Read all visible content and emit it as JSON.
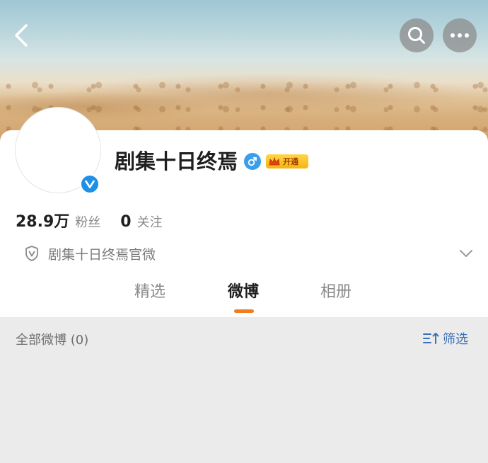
{
  "header": {
    "back_icon": "chevron-left-icon",
    "search_icon": "search-icon",
    "more_icon": "more-horizontal-icon"
  },
  "profile": {
    "name": "剧集十日终焉",
    "gender_icon": "male-icon",
    "vip_label": "开通",
    "verified_icon": "verified-v-icon",
    "followers_count": "28.9万",
    "followers_label": "粉丝",
    "following_count": "0",
    "following_label": "关注",
    "verification_text": "剧集十日终焉官微"
  },
  "tabs": [
    {
      "label": "精选",
      "active": false
    },
    {
      "label": "微博",
      "active": true
    },
    {
      "label": "相册",
      "active": false
    }
  ],
  "feed": {
    "count_label": "全部微博 (0)",
    "filter_label": "筛选"
  },
  "colors": {
    "accent": "#f07c22",
    "link_blue": "#3b6fb6",
    "verify_blue": "#1e90e6"
  }
}
